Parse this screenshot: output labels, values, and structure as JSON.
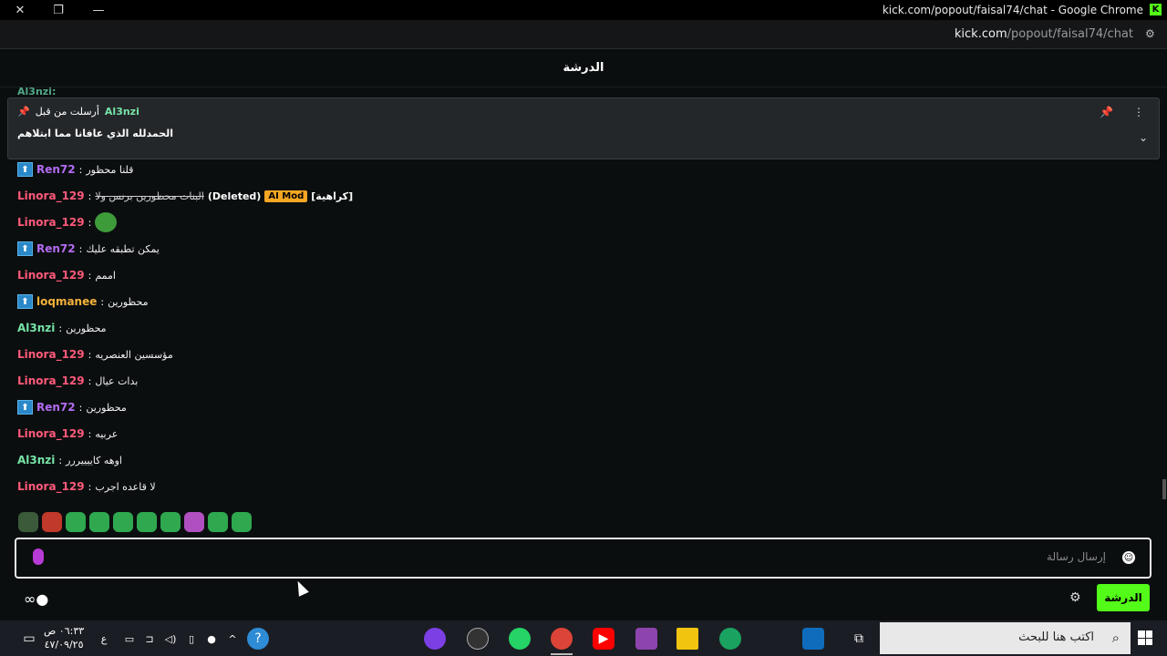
{
  "window": {
    "title": "kick.com/popout/faisal74/chat - Google Chrome",
    "url_host": "kick.com",
    "url_path": "/popout/faisal74/chat",
    "brand_color": "#53fc18"
  },
  "chat": {
    "header_title": "الدرشة",
    "partial_user": "Al3nzi:",
    "pinned": {
      "sent_by_label": "أرسلت من قبل",
      "user": "Al3nzi",
      "message": "الحمدلله الذي عافانا مما ابتلاهم"
    },
    "messages": [
      {
        "user": "Ren72",
        "color": "#b36cf2",
        "badge": true,
        "text": "قلنا محظور"
      },
      {
        "user": "Linora_129",
        "color": "#ff5a7a",
        "badge": false,
        "deleted_text": "البنات محظورين برنس ولا",
        "deleted_label": "(Deleted)",
        "mod_label": "AI Mod",
        "reason": "[كراهية]"
      },
      {
        "user": "Linora_129",
        "color": "#ff5a7a",
        "badge": false,
        "emote": "frog-emote"
      },
      {
        "user": "Ren72",
        "color": "#b36cf2",
        "badge": true,
        "text": "يمكن تطبقه عليك"
      },
      {
        "user": "Linora_129",
        "color": "#ff5a7a",
        "badge": false,
        "text": "اممم"
      },
      {
        "user": "loqmanee",
        "color": "#f5b23b",
        "badge": true,
        "text": "محظورين"
      },
      {
        "user": "Al3nzi",
        "color": "#76e4a7",
        "badge": false,
        "text": "محظورين"
      },
      {
        "user": "Linora_129",
        "color": "#ff5a7a",
        "badge": false,
        "text": "مؤسسين العنصريه"
      },
      {
        "user": "Linora_129",
        "color": "#ff5a7a",
        "badge": false,
        "text": "بدات عيال"
      },
      {
        "user": "Ren72",
        "color": "#b36cf2",
        "badge": true,
        "text": "محظورين"
      },
      {
        "user": "Linora_129",
        "color": "#ff5a7a",
        "badge": false,
        "text": "عربيه"
      },
      {
        "user": "Al3nzi",
        "color": "#76e4a7",
        "badge": false,
        "text": "اوهه كاييييررر"
      },
      {
        "user": "Linora_129",
        "color": "#ff5a7a",
        "badge": false,
        "text": "لا قاعده اجرب"
      }
    ],
    "input_placeholder": "إرسال رسالة",
    "chat_button": "الدرشة"
  },
  "taskbar": {
    "search_placeholder": "اكتب هنا للبحث",
    "time": "٠٦:٣٣ ص",
    "date": "٤٧/٠٩/٢٥",
    "lang": "ع"
  }
}
